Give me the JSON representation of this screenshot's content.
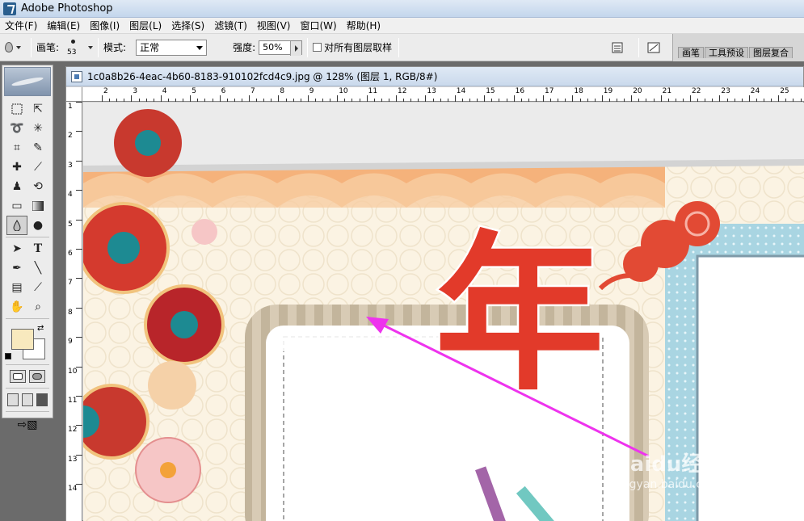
{
  "app": {
    "title": "Adobe Photoshop"
  },
  "menu": {
    "items": [
      "文件(F)",
      "编辑(E)",
      "图像(I)",
      "图层(L)",
      "选择(S)",
      "滤镜(T)",
      "视图(V)",
      "窗口(W)",
      "帮助(H)"
    ]
  },
  "options": {
    "brush_label": "画笔:",
    "brush_size": "53",
    "mode_label": "模式:",
    "mode_value": "正常",
    "strength_label": "强度:",
    "strength_value": "50%",
    "sample_all_label": "对所有图层取样",
    "palette_tabs": [
      "画笔",
      "工具预设",
      "图层复合"
    ]
  },
  "document": {
    "title": "1c0a8b26-4eac-4b60-8183-910102fcd4c9.jpg @ 128% (图层 1, RGB/8#)",
    "ruler_h": [
      "2",
      "3",
      "4",
      "5",
      "6",
      "7",
      "8",
      "9",
      "10",
      "11",
      "12",
      "13",
      "14",
      "15",
      "16",
      "17",
      "18",
      "19",
      "20",
      "21",
      "22",
      "23",
      "24",
      "25"
    ],
    "ruler_v": [
      "1",
      "2",
      "3",
      "4",
      "5",
      "6",
      "7",
      "8",
      "9",
      "10",
      "11",
      "12",
      "13",
      "14"
    ],
    "canvas_text": {
      "year_char": "年"
    }
  },
  "tools": {
    "foreground_color": "#f8e9be",
    "background_color": "#ffffff",
    "active_tool": "blur-tool"
  },
  "watermark": {
    "logo": "Baidu经验",
    "url": "jingyan.baidu.com"
  }
}
